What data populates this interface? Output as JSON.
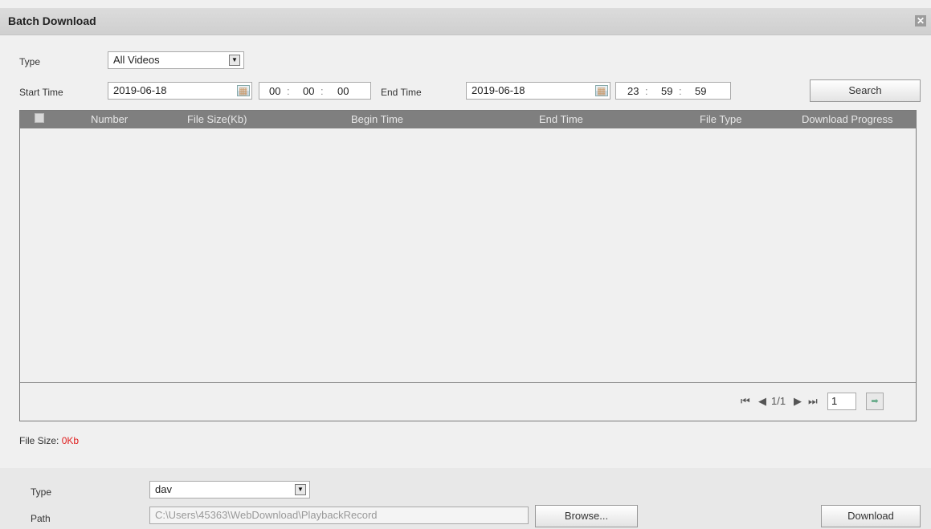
{
  "dialog": {
    "title": "Batch Download",
    "close_glyph": "✕"
  },
  "filter": {
    "type_label": "Type",
    "type_value": "All Videos",
    "start_label": "Start Time",
    "start_date": "2019-06-18",
    "start_hh": "00",
    "start_mm": "00",
    "start_ss": "00",
    "end_label": "End Time",
    "end_date": "2019-06-18",
    "end_hh": "23",
    "end_mm": "59",
    "end_ss": "59",
    "time_sep": ":",
    "search_label": "Search"
  },
  "grid": {
    "columns": [
      "Number",
      "File Size(Kb)",
      "Begin Time",
      "End Time",
      "File Type",
      "Download Progress"
    ],
    "rows": [],
    "pager": {
      "text": "1/1",
      "page_value": "1",
      "first": "⏮",
      "prev": "◀",
      "next": "▶",
      "last": "⏭",
      "go": "➡"
    }
  },
  "summary": {
    "file_size_label": "File Size:",
    "file_size_value": "0Kb",
    "value_color": "#e02020"
  },
  "download": {
    "type_label": "Type",
    "type_value": "dav",
    "path_label": "Path",
    "path_value": "C:\\Users\\45363\\WebDownload\\PlaybackRecord",
    "browse_label": "Browse...",
    "download_label": "Download"
  }
}
